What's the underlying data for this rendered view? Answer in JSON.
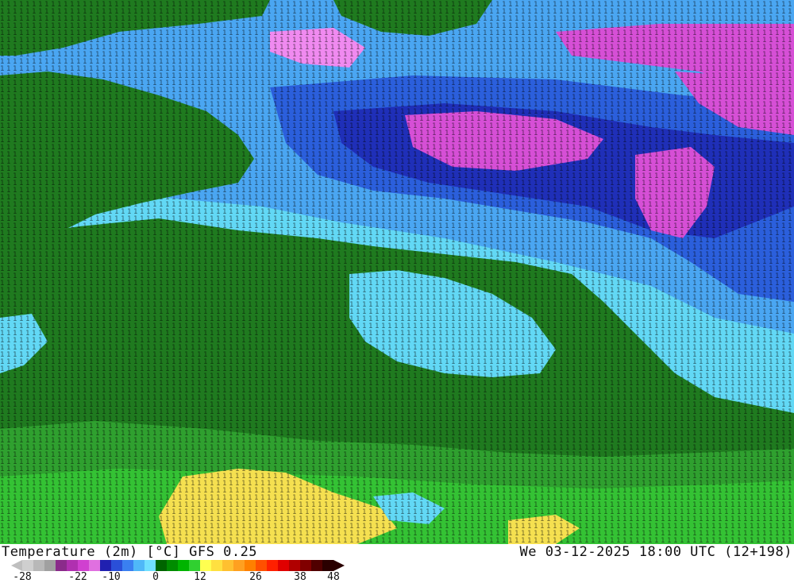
{
  "title": {
    "left": "Temperature (2m) [°C] GFS 0.25",
    "right": "We 03-12-2025 18:00 UTC (12+198)"
  },
  "colorbar": {
    "colors": [
      "#cfcfcf",
      "#b8b8b8",
      "#a0a0a0",
      "#8a2b8a",
      "#b030b0",
      "#d040d0",
      "#e070e0",
      "#2020b0",
      "#2a4fd8",
      "#3a7ff0",
      "#4fb8f8",
      "#70e0ff",
      "#006400",
      "#008c00",
      "#00b400",
      "#30d030",
      "#ffff50",
      "#ffe040",
      "#ffc030",
      "#ffa020",
      "#ff8000",
      "#ff5000",
      "#ff2000",
      "#e00000",
      "#b00000",
      "#800000",
      "#500000",
      "#2a0000"
    ],
    "ticks": [
      {
        "label": "-28",
        "index": 0
      },
      {
        "label": "-22",
        "index": 5
      },
      {
        "label": "-10",
        "index": 8
      },
      {
        "label": "0",
        "index": 12
      },
      {
        "label": "12",
        "index": 16
      },
      {
        "label": "26",
        "index": 21
      },
      {
        "label": "38",
        "index": 25
      },
      {
        "label": "48",
        "index": 28
      }
    ]
  },
  "map": {
    "fill_colors": {
      "land_green": "#1f7a1f",
      "light_green": "#2fa02f",
      "bright_green": "#34c234",
      "yellow": "#f5e050",
      "cyan": "#62d8f5",
      "light_blue": "#4aa6f2",
      "blue": "#2b5fdc",
      "dark_blue": "#1f2fb8",
      "magenta": "#d64fd6",
      "pink": "#f08af0"
    }
  }
}
